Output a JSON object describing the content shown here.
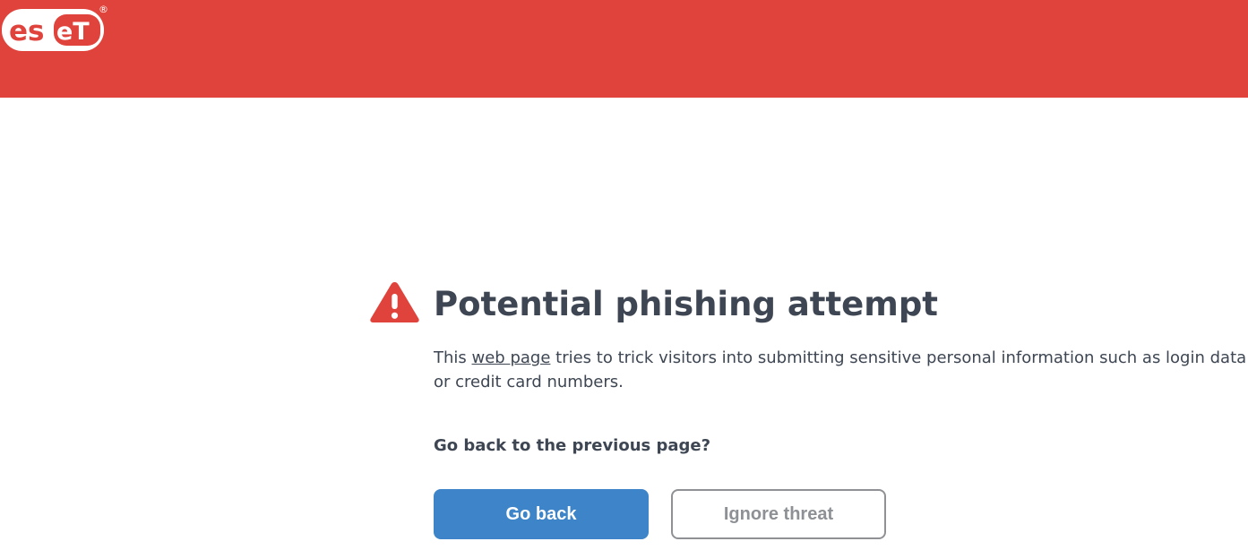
{
  "brand": {
    "logo_text": "eset",
    "registered_mark": "®",
    "header_color": "#e0433b"
  },
  "alert": {
    "icon": "warning-triangle-icon",
    "icon_color": "#e0433b",
    "title": "Potential phishing attempt",
    "description_prefix": "This ",
    "description_link": "web page",
    "description_suffix": " tries to trick visitors into submitting sensitive personal information such as login data or credit card numbers.",
    "question": "Go back to the previous page?"
  },
  "actions": {
    "go_back_label": "Go back",
    "ignore_label": "Ignore threat",
    "primary_color": "#3d84c8"
  }
}
